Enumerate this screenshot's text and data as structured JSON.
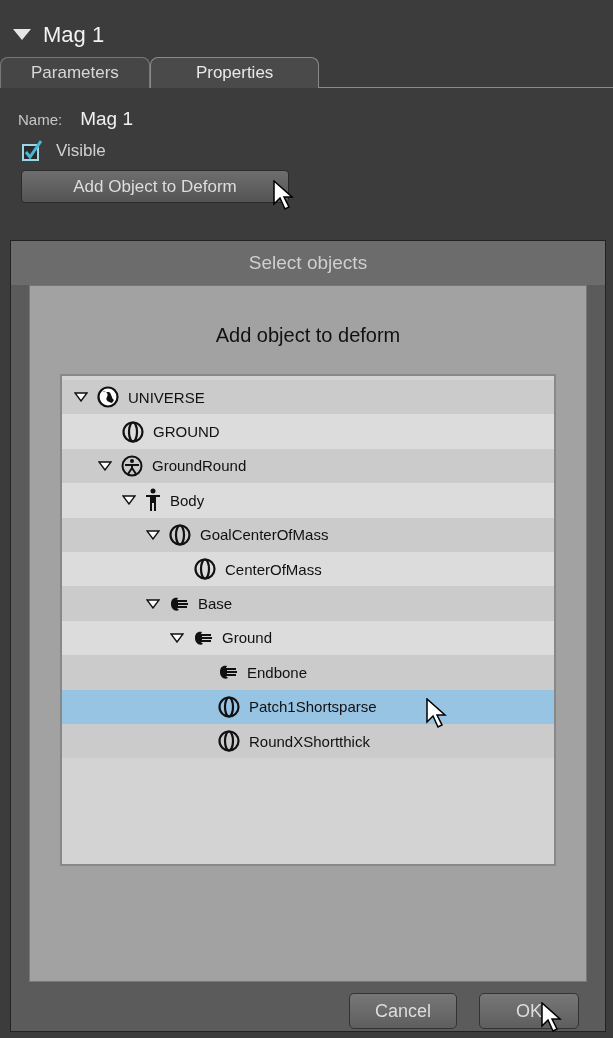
{
  "panel": {
    "title": "Mag 1",
    "expanded": true
  },
  "tabs": [
    {
      "label": "Parameters",
      "selected": false
    },
    {
      "label": "Properties",
      "selected": true
    }
  ],
  "name_field": {
    "label": "Name:",
    "value": "Mag 1"
  },
  "visible_checkbox": {
    "label": "Visible",
    "checked": true
  },
  "add_button": "Add Object to Deform",
  "dialog": {
    "title": "Select objects",
    "heading": "Add object to deform",
    "tree": [
      {
        "label": "UNIVERSE",
        "kind": "globe",
        "expanded": true,
        "selected": false,
        "children": [
          {
            "label": "GROUND",
            "kind": "prop",
            "selected": false
          },
          {
            "label": "GroundRound",
            "kind": "figure",
            "expanded": true,
            "selected": false,
            "children": [
              {
                "label": "Body",
                "kind": "body",
                "expanded": true,
                "selected": false,
                "children": [
                  {
                    "label": "GoalCenterOfMass",
                    "kind": "prop",
                    "expanded": true,
                    "selected": false,
                    "children": [
                      {
                        "label": "CenterOfMass",
                        "kind": "prop",
                        "selected": false
                      }
                    ]
                  },
                  {
                    "label": "Base",
                    "kind": "bone",
                    "expanded": true,
                    "selected": false,
                    "children": [
                      {
                        "label": "Ground",
                        "kind": "bone",
                        "expanded": true,
                        "selected": false,
                        "children": [
                          {
                            "label": "Endbone",
                            "kind": "bone",
                            "selected": false
                          },
                          {
                            "label": "Patch1Shortsparse",
                            "kind": "prop",
                            "selected": true
                          },
                          {
                            "label": "RoundXShortthick",
                            "kind": "prop",
                            "selected": false
                          }
                        ]
                      }
                    ]
                  }
                ]
              }
            ]
          }
        ]
      }
    ],
    "buttons": [
      "Cancel",
      "OK"
    ]
  }
}
